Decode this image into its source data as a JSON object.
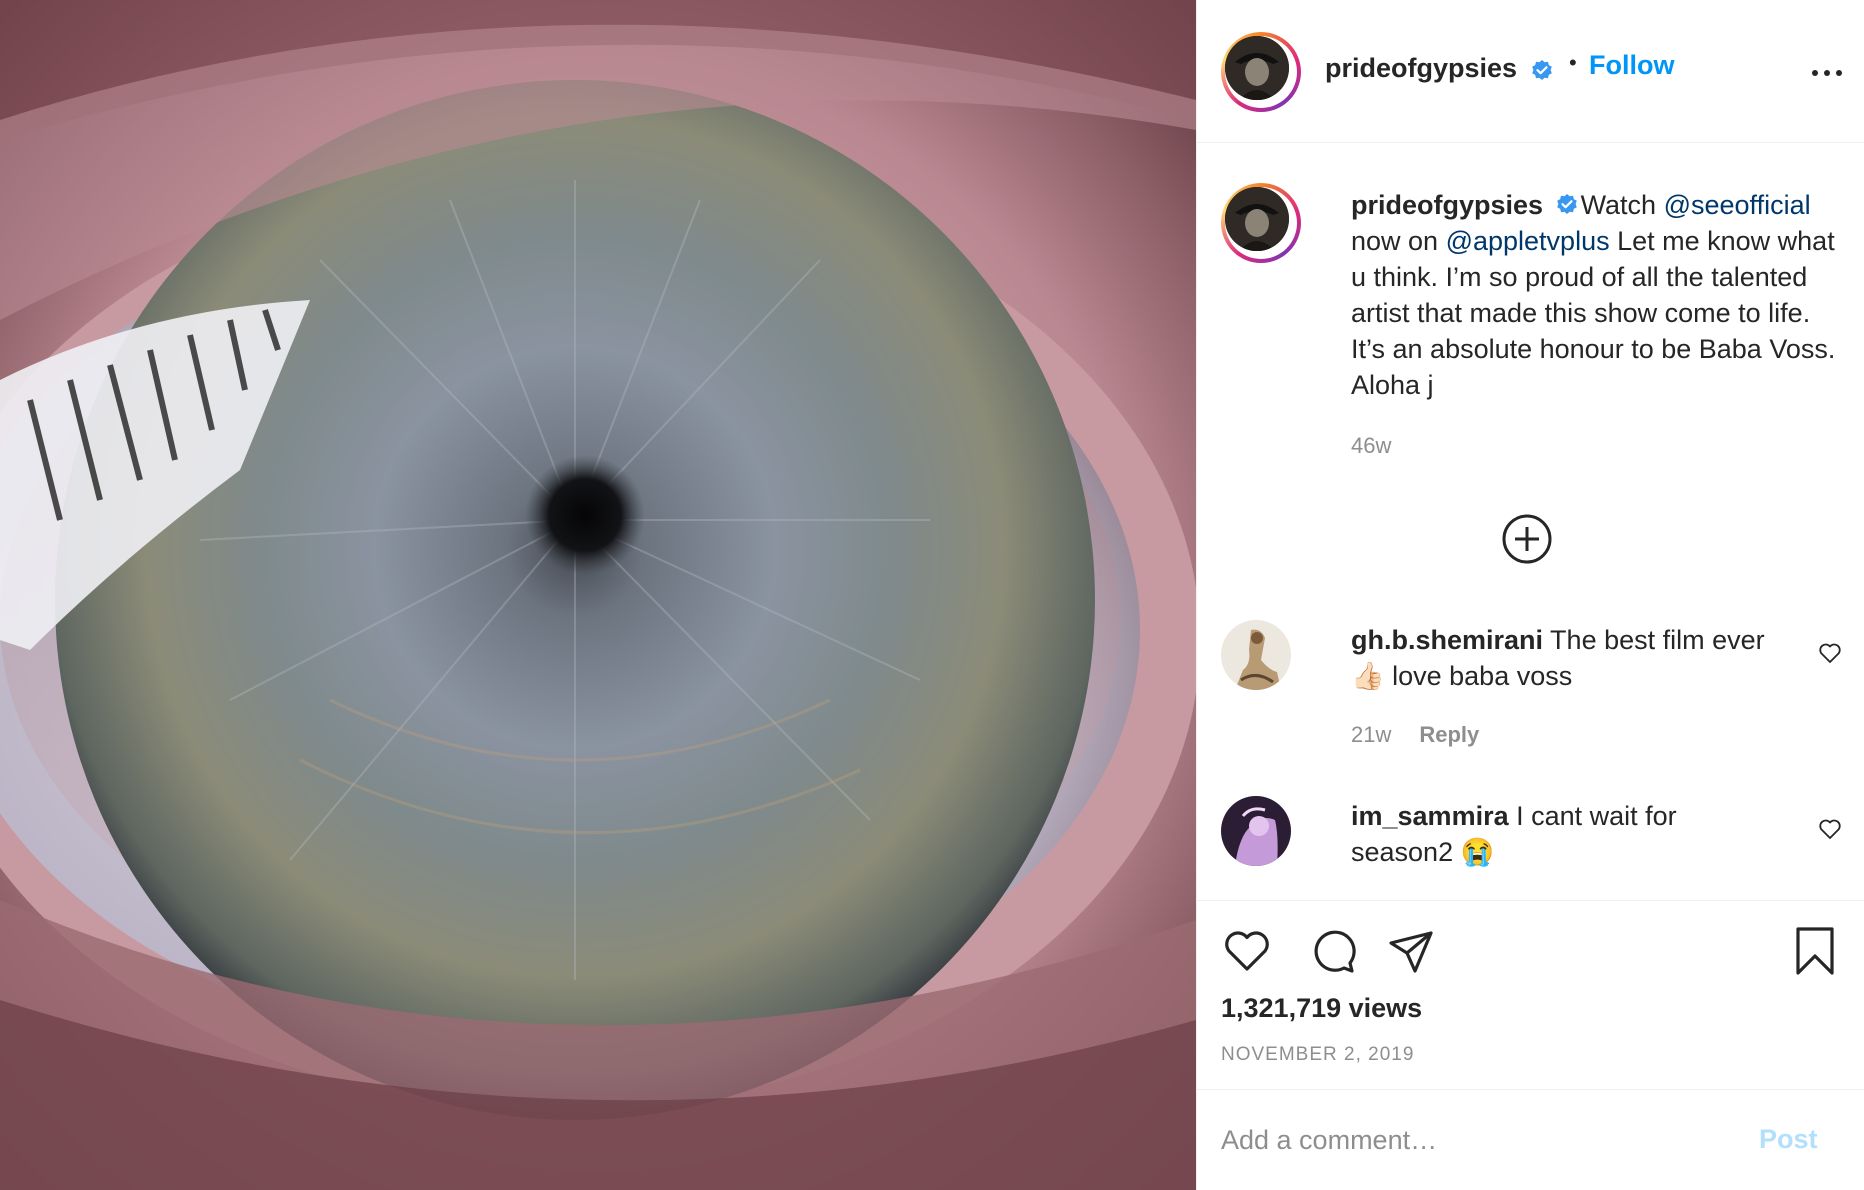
{
  "post": {
    "media": {
      "description_icon": "eye-closeup-video"
    },
    "header": {
      "username": "prideofgypsies",
      "separator": "•",
      "follow_label": "Follow",
      "more_icon": "more-horizontal-icon"
    },
    "caption": {
      "username": "prideofgypsies",
      "text_1": "Watch ",
      "mention_1": "@seeofficial",
      "text_2": " now on ",
      "mention_2": "@appletvplus",
      "text_3": " Let me know what u think. I’m so proud of all the talented artist that made this show come to life. It’s an absolute honour to be Baba Voss. Aloha j",
      "time": "46w"
    },
    "comments": [
      {
        "username": "gh.b.shemirani",
        "text": " The best film ever 👍🏻 love baba voss",
        "time": "21w",
        "reply_label": "Reply"
      },
      {
        "username": "im_sammira",
        "text": " I cant wait for season2 😭"
      }
    ],
    "stats": {
      "views": "1,321,719 views",
      "date": "NOVEMBER 2, 2019"
    },
    "add_comment": {
      "placeholder": "Add a comment…",
      "post_label": "Post"
    },
    "colors": {
      "accent": "#0095f6",
      "mention": "#00376b",
      "muted": "#8e8e8e",
      "post_disabled": "#b2dffc",
      "verified": "#3897f0"
    }
  }
}
